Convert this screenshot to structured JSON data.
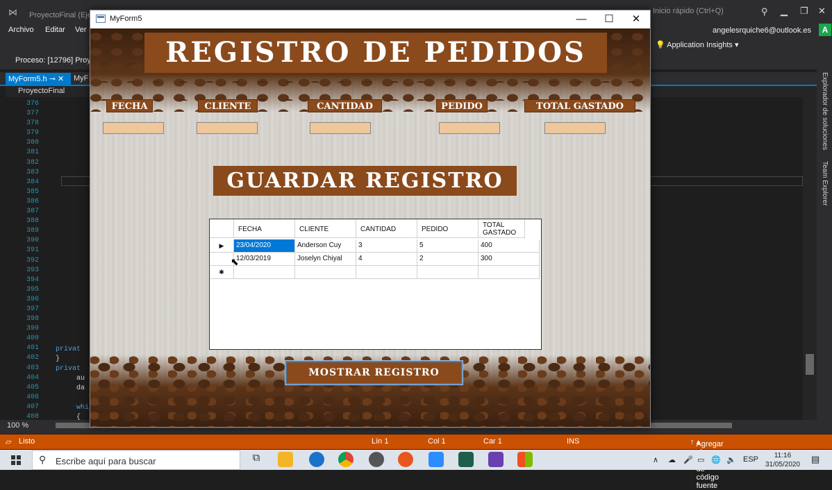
{
  "vs": {
    "title": "ProyectoFinal (Eje",
    "quick_launch": "Inicio rápido (Ctrl+Q)",
    "menu": [
      "Archivo",
      "Editar",
      "Ver"
    ],
    "account": "angelesrquiche6@outlook.es",
    "avatar": "A",
    "app_insights": "Application Insights",
    "process": "Proceso:  [12796] Proy",
    "tab_active": "MyForm5.h",
    "tab_second": "MyF",
    "project": "ProyectoFinal",
    "line_numbers": [
      "376",
      "377",
      "378",
      "379",
      "380",
      "381",
      "382",
      "383",
      "384",
      "385",
      "386",
      "387",
      "388",
      "389",
      "390",
      "391",
      "392",
      "393",
      "394",
      "395",
      "396",
      "397",
      "398",
      "399",
      "400",
      "401",
      "402",
      "403",
      "404",
      "405",
      "406",
      "407",
      "408"
    ],
    "code_snippets": {
      "l401": "privat",
      "l402": "}",
      "l403": "privat",
      "l404": "au",
      "l405": "da",
      "l407": "whi",
      "l408": "{"
    },
    "side_panels": [
      "Explorador de soluciones",
      "Team Explorer"
    ],
    "zoom": "100 %",
    "status": {
      "ready": "Listo",
      "line": "Lín 1",
      "col": "Col 1",
      "car": "Car 1",
      "ins": "INS",
      "source_control": "Agregar al control de código fuente"
    }
  },
  "taskbar": {
    "search_placeholder": "Escribe aquí para buscar",
    "language": "ESP",
    "time": "11:16",
    "date": "31/05/2020"
  },
  "form": {
    "window_title": "MyForm5",
    "main_title": "REGISTRO DE PEDIDOS",
    "labels": {
      "fecha": "FECHA",
      "cliente": "CLIENTE",
      "cantidad": "CANTIDAD",
      "pedido": "PEDIDO",
      "total": "TOTAL GASTADO"
    },
    "inputs": {
      "fecha": "",
      "cliente": "",
      "cantidad": "",
      "pedido": "",
      "total": ""
    },
    "save_title": "GUARDAR REGISTRO",
    "show_button": "MOSTRAR REGISTRO",
    "grid": {
      "columns": [
        "FECHA",
        "CLIENTE",
        "CANTIDAD",
        "PEDIDO",
        "TOTAL GASTADO"
      ],
      "rows": [
        [
          "23/04/2020",
          "Anderson Cuy",
          "3",
          "5",
          "400"
        ],
        [
          "12/03/2019",
          "Joselyn Chiyal",
          "4",
          "2",
          "300"
        ]
      ],
      "selected_cell": "23/04/2020"
    }
  }
}
